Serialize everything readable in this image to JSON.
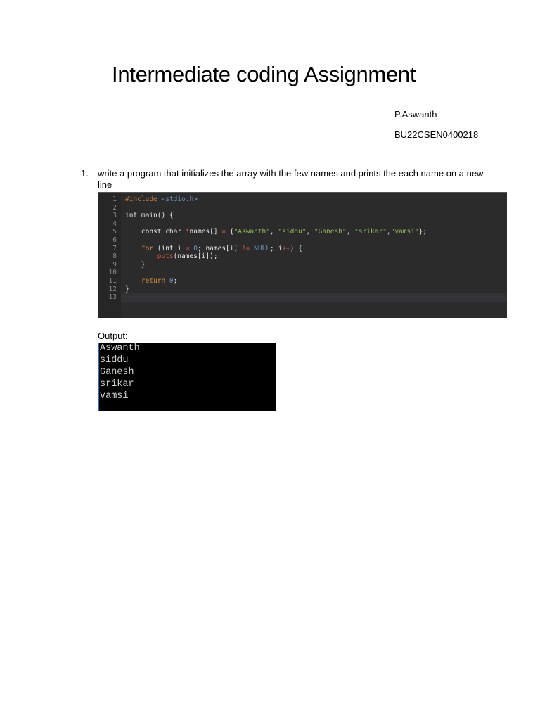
{
  "document": {
    "title": "Intermediate coding Assignment",
    "author": "P.Aswanth",
    "reg_no": "BU22CSEN0400218",
    "question": {
      "number": "1.",
      "text": "write a program that initializes the array with the few names and prints the each name on a new line"
    },
    "code": {
      "line_numbers": [
        "1",
        "2",
        "3",
        "4",
        "5",
        "6",
        "7",
        "8",
        "9",
        "10",
        "11",
        "12",
        "13"
      ],
      "lines": [
        [
          {
            "t": "#include ",
            "c": "k-pre"
          },
          {
            "t": "<stdio.h>",
            "c": "k-inc"
          }
        ],
        [],
        [
          {
            "t": "int main() {",
            "c": "k-kw"
          }
        ],
        [],
        [
          {
            "t": "    const char ",
            "c": "k-kw"
          },
          {
            "t": "*",
            "c": "k-op"
          },
          {
            "t": "names[] ",
            "c": "k-txt"
          },
          {
            "t": "=",
            "c": "k-op"
          },
          {
            "t": " {",
            "c": "k-txt"
          },
          {
            "t": "\"Aswanth\"",
            "c": "k-str"
          },
          {
            "t": ", ",
            "c": "k-txt"
          },
          {
            "t": "\"siddu\"",
            "c": "k-str"
          },
          {
            "t": ", ",
            "c": "k-txt"
          },
          {
            "t": "\"Ganesh\"",
            "c": "k-str"
          },
          {
            "t": ", ",
            "c": "k-txt"
          },
          {
            "t": "\"srikar\"",
            "c": "k-str"
          },
          {
            "t": ",",
            "c": "k-txt"
          },
          {
            "t": "\"vamsi\"",
            "c": "k-str"
          },
          {
            "t": "};",
            "c": "k-txt"
          }
        ],
        [],
        [
          {
            "t": "    for",
            "c": "k-kw2"
          },
          {
            "t": " (int i ",
            "c": "k-txt"
          },
          {
            "t": "=",
            "c": "k-op"
          },
          {
            "t": " ",
            "c": "k-txt"
          },
          {
            "t": "0",
            "c": "k-num"
          },
          {
            "t": "; names[i] ",
            "c": "k-txt"
          },
          {
            "t": "!=",
            "c": "k-op"
          },
          {
            "t": " ",
            "c": "k-txt"
          },
          {
            "t": "NULL",
            "c": "k-num"
          },
          {
            "t": "; i",
            "c": "k-txt"
          },
          {
            "t": "++",
            "c": "k-op"
          },
          {
            "t": ") {",
            "c": "k-txt"
          }
        ],
        [
          {
            "t": "        puts",
            "c": "k-fn"
          },
          {
            "t": "(names[i]);",
            "c": "k-txt"
          }
        ],
        [
          {
            "t": "    }",
            "c": "k-txt"
          }
        ],
        [],
        [
          {
            "t": "    return ",
            "c": "k-kw2"
          },
          {
            "t": "0",
            "c": "k-num"
          },
          {
            "t": ";",
            "c": "k-txt"
          }
        ],
        [
          {
            "t": "}",
            "c": "k-txt"
          }
        ],
        []
      ]
    },
    "output_label": "Output:",
    "output_lines": [
      "Aswanth",
      "siddu",
      "Ganesh",
      "srikar",
      "vamsi"
    ]
  }
}
